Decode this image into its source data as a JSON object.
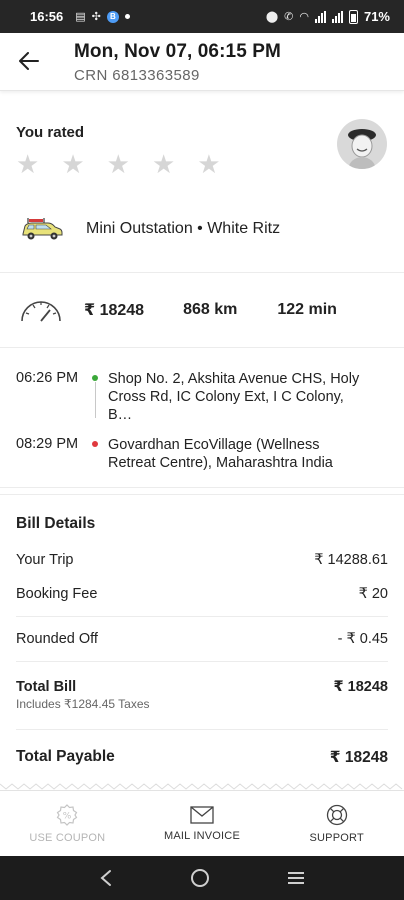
{
  "status_bar": {
    "time": "16:56",
    "battery": "71%",
    "badge": "B"
  },
  "header": {
    "title": "Mon, Nov 07, 06:15 PM",
    "crn": "CRN 6813363589"
  },
  "rating": {
    "label": "You rated",
    "stars_total": 5,
    "stars_filled": 0
  },
  "vehicle": {
    "name": "Mini Outstation • White Ritz",
    "icon": "car-icon"
  },
  "trip": {
    "fare": "₹ 18248",
    "distance": "868 km",
    "duration": "122 min"
  },
  "route": {
    "pickup": {
      "time": "06:26 PM",
      "address": "Shop No. 2, Akshita Avenue CHS, Holy Cross Rd, IC Colony Ext, I C Colony, B…"
    },
    "drop": {
      "time": "08:29 PM",
      "address": "Govardhan EcoVillage (Wellness Retreat Centre), Maharashtra India"
    }
  },
  "bill": {
    "title": "Bill Details",
    "your_trip": {
      "label": "Your Trip",
      "value": "₹ 14288.61"
    },
    "booking_fee": {
      "label": "Booking Fee",
      "value": "₹ 20"
    },
    "rounded_off": {
      "label": "Rounded Off",
      "value": "- ₹ 0.45"
    },
    "total_bill": {
      "label": "Total Bill",
      "note": "Includes ₹1284.45 Taxes",
      "value": "₹ 18248"
    },
    "total_payable": {
      "label": "Total Payable",
      "value": "₹ 18248"
    }
  },
  "actions": {
    "coupon": "USE COUPON",
    "mail": "MAIL INVOICE",
    "support": "SUPPORT"
  },
  "colors": {
    "pickup_dot": "#3aa839",
    "drop_dot": "#e0393e",
    "status_bar": "#262626"
  }
}
